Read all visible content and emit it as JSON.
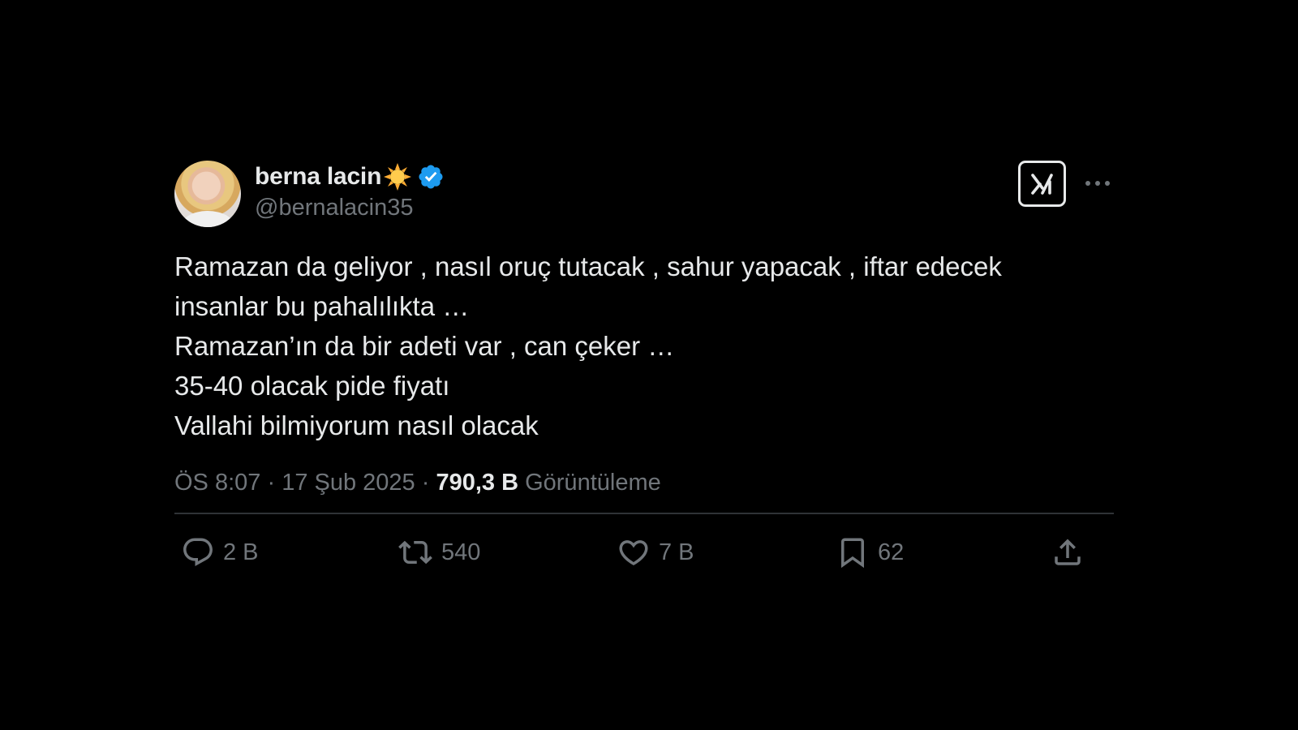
{
  "tweet": {
    "author": {
      "display_name": "berna lacin",
      "emoji": "sun-emoji",
      "verified": true,
      "handle": "@bernalacin35"
    },
    "header_buttons": [
      "grok-icon",
      "more-icon"
    ],
    "lines": [
      "Ramazan da geliyor , nasıl oruç tutacak , sahur yapacak , iftar edecek",
      "insanlar bu pahalılıkta …",
      "Ramazan’ın da bir adeti var , can çeker …",
      "35-40 olacak pide fiyatı",
      "Vallahi bilmiyorum nasıl olacak"
    ],
    "meta": {
      "time": "ÖS 8:07",
      "date": "17 Şub 2025",
      "sep": " · ",
      "views_count": "790,3 B",
      "views_label": "Görüntüleme"
    },
    "actions": {
      "replies": "2 B",
      "reposts": "540",
      "likes": "7 B",
      "bookmarks": "62"
    }
  },
  "colors": {
    "background": "#000000",
    "text": "#e7e9ea",
    "secondary": "#71767b",
    "verified": "#1d9bf0",
    "divider": "#2f3336"
  }
}
